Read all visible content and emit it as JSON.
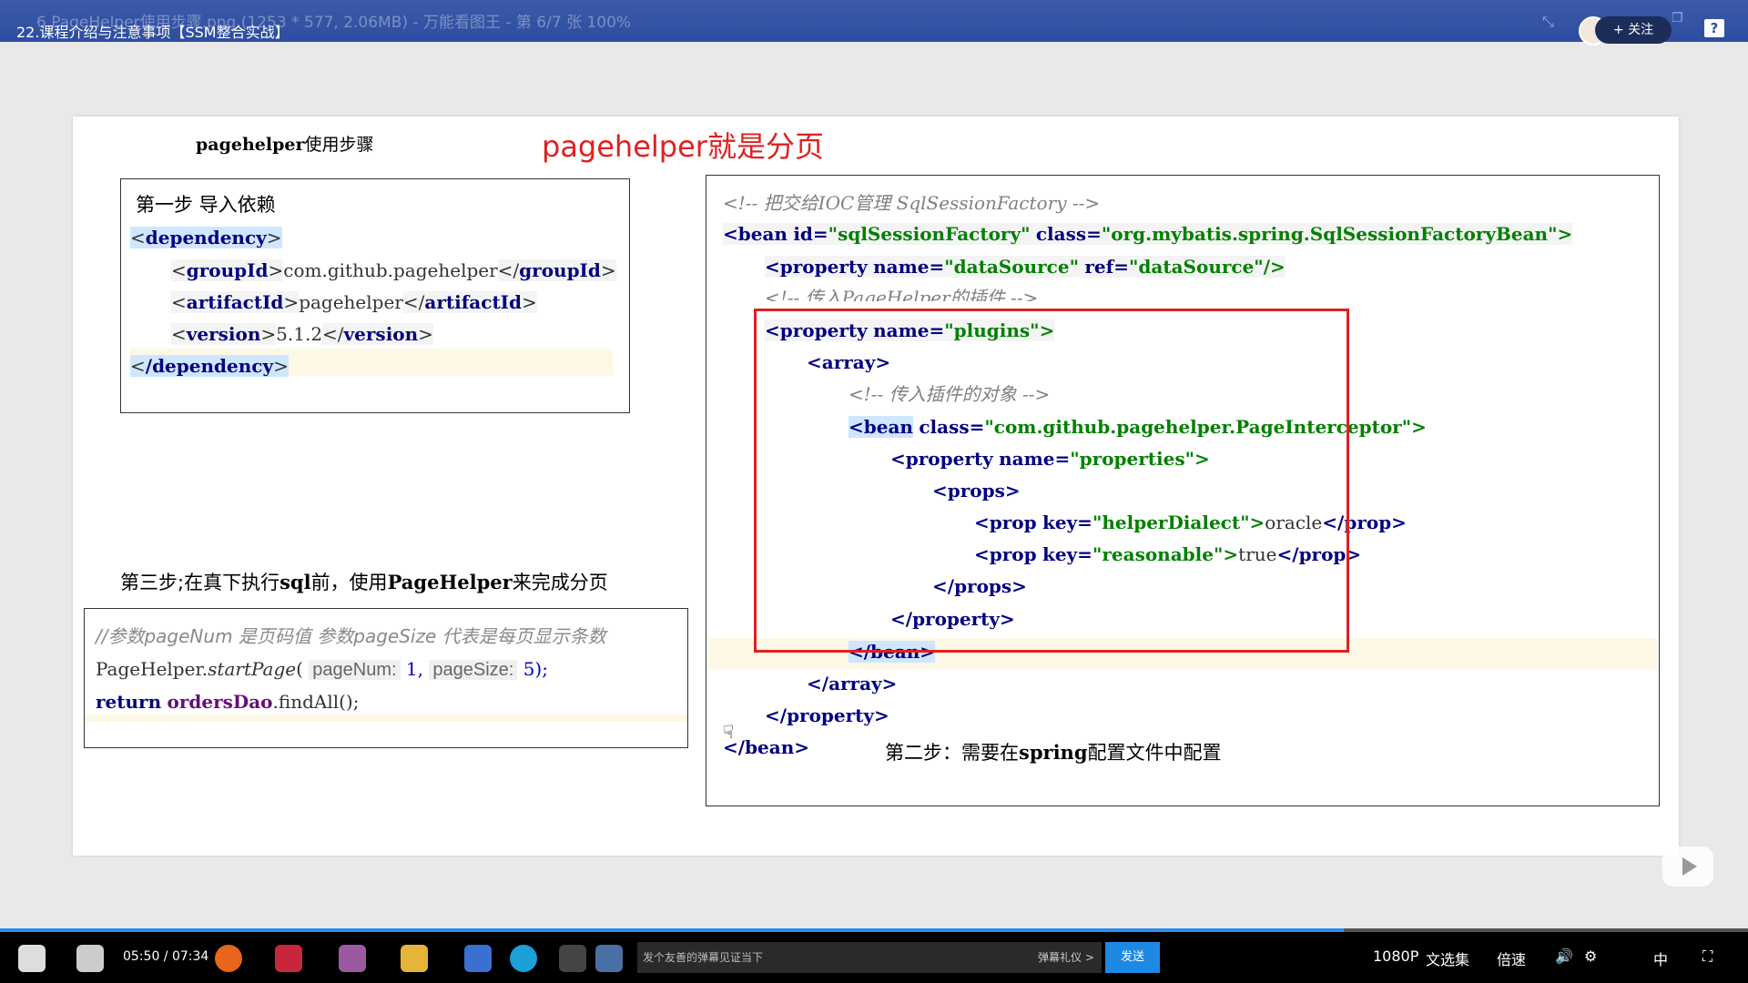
{
  "topbar": {
    "bg_title": "6.PageHelper使用步骤.png (1253 * 577, 2.06MB) - 万能看图王 - 第 6/7 张 100%",
    "video_title": "22.课程介绍与注意事项【SSM整合实战】",
    "follow_label": "+ 关注",
    "help_label": "?"
  },
  "slide": {
    "steps_heading_code": "pagehelper",
    "steps_heading_text": "使用步骤",
    "red_title": "pagehelper就是分页",
    "step1": {
      "label": "第一步 导入依赖",
      "lines": {
        "dep_open": "dependency",
        "group_tag": "groupId",
        "group_val": "com.github.pagehelper",
        "artifact_tag": "artifactId",
        "artifact_val": "pagehelper",
        "version_tag": "version",
        "version_val": "5.1.2",
        "dep_close": "/dependency"
      }
    },
    "step3": {
      "label_a": "第三步;在真下执行",
      "label_code1": "sql",
      "label_b": "前，使用",
      "label_code2": "PageHelper",
      "label_c": "来完成分页",
      "comment": "//参数pageNum 是页码值    参数pageSize 代表是每页显示条数",
      "line2_a": "PageHelper.",
      "line2_method": "startPage",
      "line2_paren": "(",
      "hint1": "pageNum:",
      "val1": "1,",
      "hint2": "pageSize:",
      "val2": "5);",
      "line3_kw": "return",
      "line3_obj": "ordersDao",
      "line3_rest": ".findAll();"
    },
    "step2": {
      "label_a": "第二步：需要在",
      "label_code": "spring",
      "label_b": "配置文件中配置",
      "c1": "<!-- 把交给IOC管理 SqlSessionFactory -->",
      "bean_tag": "<bean",
      "bean_id_attr": "id=",
      "bean_id_val": "\"sqlSessionFactory\"",
      "bean_class_attr": "class=",
      "bean_class_val": "\"org.mybatis.spring.SqlSessionFactoryBean\">",
      "prop_ds_tag": "<property",
      "prop_ds_name": "name=",
      "prop_ds_nameval": "\"dataSource\"",
      "prop_ds_ref": "ref=",
      "prop_ds_refval": "\"dataSource\"/>",
      "c2": "<!-- 传入PageHelper的插件 -->",
      "prop_plugins_tag": "<property",
      "prop_plugins_name": "name=",
      "prop_plugins_val": "\"plugins\">",
      "array_open": "<array>",
      "c3": "<!-- 传入插件的对象 -->",
      "inner_bean_tag": "<bean",
      "inner_bean_class": "class=",
      "inner_bean_val": "\"com.github.pagehelper.PageInterceptor\">",
      "prop_props_tag": "<property",
      "prop_props_name": "name=",
      "prop_props_val": "\"properties\">",
      "props_open": "<props>",
      "prop1_tag": "<prop",
      "prop1_key": "key=",
      "prop1_keyval": "\"helperDialect\">",
      "prop1_text": "oracle",
      "prop1_close": "</prop>",
      "prop2_tag": "<prop",
      "prop2_key": "key=",
      "prop2_keyval": "\"reasonable\">",
      "prop2_text": "true",
      "prop2_close": "</prop>",
      "props_close": "</props>",
      "property_close1": "</property>",
      "bean_close1": "</bean>",
      "array_close": "</array>",
      "property_close2": "</property>",
      "bean_close2": "</bean>"
    }
  },
  "taskbar": {
    "time": "05:50 / 07:34",
    "danmaku_placeholder": "发个友善的弹幕见证当下",
    "danmaku_etiquette": "弹幕礼仪 >",
    "send_label": "发送",
    "quality": "1080P",
    "playlist": "文选集",
    "speed": "倍速",
    "lang": "中"
  },
  "colors": {
    "accent": "#2d4da0",
    "red_title": "#e02020",
    "highlight_box": "#e02020",
    "send_button": "#1e88e5"
  }
}
